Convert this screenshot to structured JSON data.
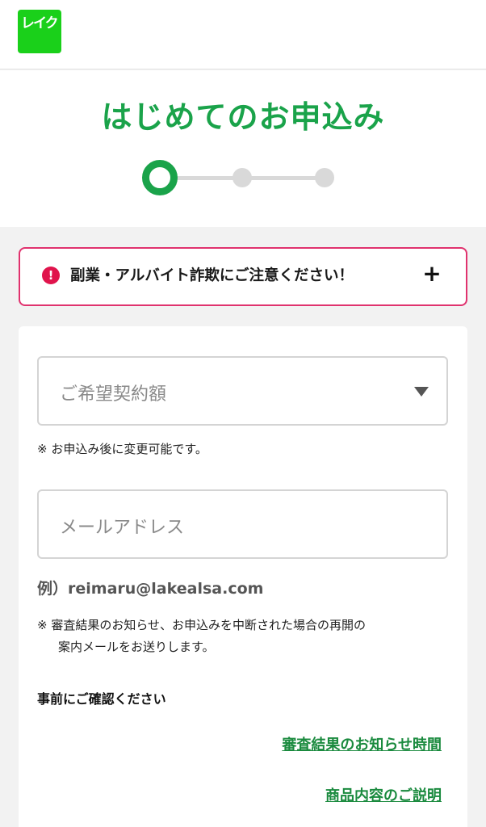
{
  "header": {
    "logo_text": "レイク"
  },
  "hero": {
    "title": "はじめてのお申込み"
  },
  "alert": {
    "icon": "!",
    "message": "副業・アルバイト詐欺にご注意ください！",
    "expand": "+"
  },
  "form": {
    "contract_amount": {
      "placeholder": "ご希望契約額",
      "note": "※ お申込み後に変更可能です。"
    },
    "email": {
      "placeholder": "メールアドレス",
      "example": "例）reimaru@lakealsa.com",
      "note_line1": "※ 審査結果のお知らせ、お申込みを中断された場合の再開の",
      "note_line2": "案内メールをお送りします。"
    }
  },
  "confirm": {
    "heading": "事前にご確認ください",
    "links": [
      "審査結果のお知らせ時間",
      "商品内容のご説明"
    ]
  },
  "colors": {
    "brand_green": "#1aa34a",
    "logo_green": "#1ad01a",
    "alert_border": "#e0326e",
    "link_green": "#1a8a3e"
  }
}
